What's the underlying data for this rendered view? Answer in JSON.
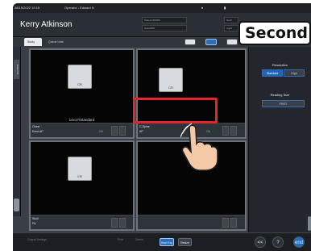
{
  "topbar": {
    "datetime": "08/15/2022 19:15",
    "operator": "Operator : Edward N"
  },
  "header": {
    "patient_name": "Kerry Atkinson",
    "info_fields": [
      "Patient ID0000",
      "Date0000",
      "Sex0",
      "Age0"
    ]
  },
  "tabs": [
    {
      "label": "Study"
    },
    {
      "label": "Queue Lists"
    }
  ],
  "left_rail_tag": "Exam list",
  "panels": [
    {
      "thumb": "CR",
      "caption": "14x17/Standard",
      "row1": "Chest",
      "row2": "Erect AP",
      "status": "OK"
    },
    {
      "thumb": "CR",
      "caption": "",
      "row1": "C-Spine",
      "row2": "AP",
      "status": "OK"
    },
    {
      "thumb": "CR",
      "caption": "",
      "row1": "Skull",
      "row2": "PA",
      "status": ""
    },
    {
      "thumb": "",
      "caption": "",
      "row1": "",
      "row2": "",
      "status": ""
    }
  ],
  "right_panel": {
    "resolution_title": "Resolution",
    "resolution_options": [
      "Standard",
      "High"
    ],
    "resolution_selected": "Standard",
    "reading_size_title": "Reading Size",
    "reading_size_value": "FRET"
  },
  "bottombar": {
    "left_labels": [
      "Output Settings",
      "Print",
      "Delete"
    ],
    "buttons": [
      "Start Exp",
      "Resize"
    ],
    "round_buttons": [
      "<<",
      "?",
      "end"
    ]
  },
  "callout": {
    "text": "Second"
  },
  "colors": {
    "highlight": "#e3262a",
    "selected_blue": "#1f64b6",
    "ok_green": "#46d36a"
  }
}
